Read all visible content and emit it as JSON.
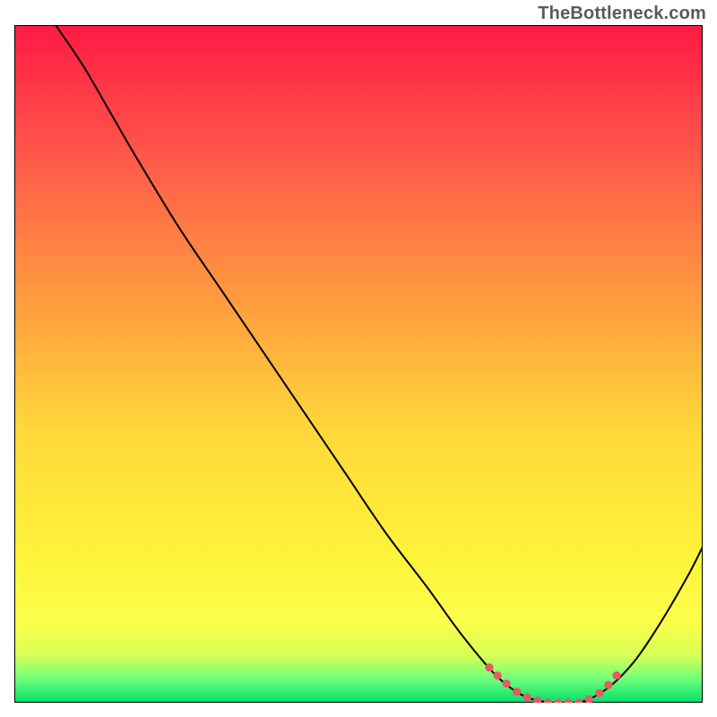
{
  "watermark": "TheBottleneck.com",
  "chart_data": {
    "type": "line",
    "title": "",
    "xlabel": "",
    "ylabel": "",
    "xlim": [
      0,
      100
    ],
    "ylim": [
      0,
      100
    ],
    "grid": false,
    "legend": false,
    "gradient_stops": [
      {
        "offset": 0.0,
        "color": "#ff1a44"
      },
      {
        "offset": 0.2,
        "color": "#ff5a4a"
      },
      {
        "offset": 0.4,
        "color": "#ff9a3f"
      },
      {
        "offset": 0.6,
        "color": "#ffd83a"
      },
      {
        "offset": 0.78,
        "color": "#fff23a"
      },
      {
        "offset": 0.88,
        "color": "#fbff4a"
      },
      {
        "offset": 0.93,
        "color": "#d8ff55"
      },
      {
        "offset": 0.965,
        "color": "#6fff7a"
      },
      {
        "offset": 1.0,
        "color": "#00e06a"
      }
    ],
    "series": [
      {
        "name": "curve",
        "style": "black-line",
        "points": [
          {
            "x": 6,
            "y": 100
          },
          {
            "x": 10,
            "y": 94
          },
          {
            "x": 14,
            "y": 87
          },
          {
            "x": 18,
            "y": 80
          },
          {
            "x": 24,
            "y": 70
          },
          {
            "x": 30,
            "y": 61
          },
          {
            "x": 36,
            "y": 52
          },
          {
            "x": 42,
            "y": 43
          },
          {
            "x": 48,
            "y": 34
          },
          {
            "x": 54,
            "y": 25
          },
          {
            "x": 60,
            "y": 17
          },
          {
            "x": 65,
            "y": 10
          },
          {
            "x": 70,
            "y": 4
          },
          {
            "x": 74,
            "y": 1
          },
          {
            "x": 78,
            "y": 0
          },
          {
            "x": 82,
            "y": 0
          },
          {
            "x": 86,
            "y": 2
          },
          {
            "x": 90,
            "y": 6
          },
          {
            "x": 94,
            "y": 12
          },
          {
            "x": 98,
            "y": 19
          },
          {
            "x": 100,
            "y": 23
          }
        ]
      },
      {
        "name": "sweet-spot-dots",
        "style": "red-dots",
        "points": [
          {
            "x": 69,
            "y": 5.2
          },
          {
            "x": 70.2,
            "y": 4.0
          },
          {
            "x": 71.5,
            "y": 2.8
          },
          {
            "x": 73,
            "y": 1.6
          },
          {
            "x": 74.5,
            "y": 0.8
          },
          {
            "x": 76,
            "y": 0.3
          },
          {
            "x": 77.5,
            "y": 0.0
          },
          {
            "x": 79,
            "y": 0.0
          },
          {
            "x": 80.5,
            "y": 0.0
          },
          {
            "x": 82,
            "y": 0.0
          },
          {
            "x": 83.5,
            "y": 0.5
          },
          {
            "x": 85,
            "y": 1.4
          },
          {
            "x": 86.3,
            "y": 2.6
          },
          {
            "x": 87.5,
            "y": 4.0
          }
        ]
      }
    ]
  }
}
